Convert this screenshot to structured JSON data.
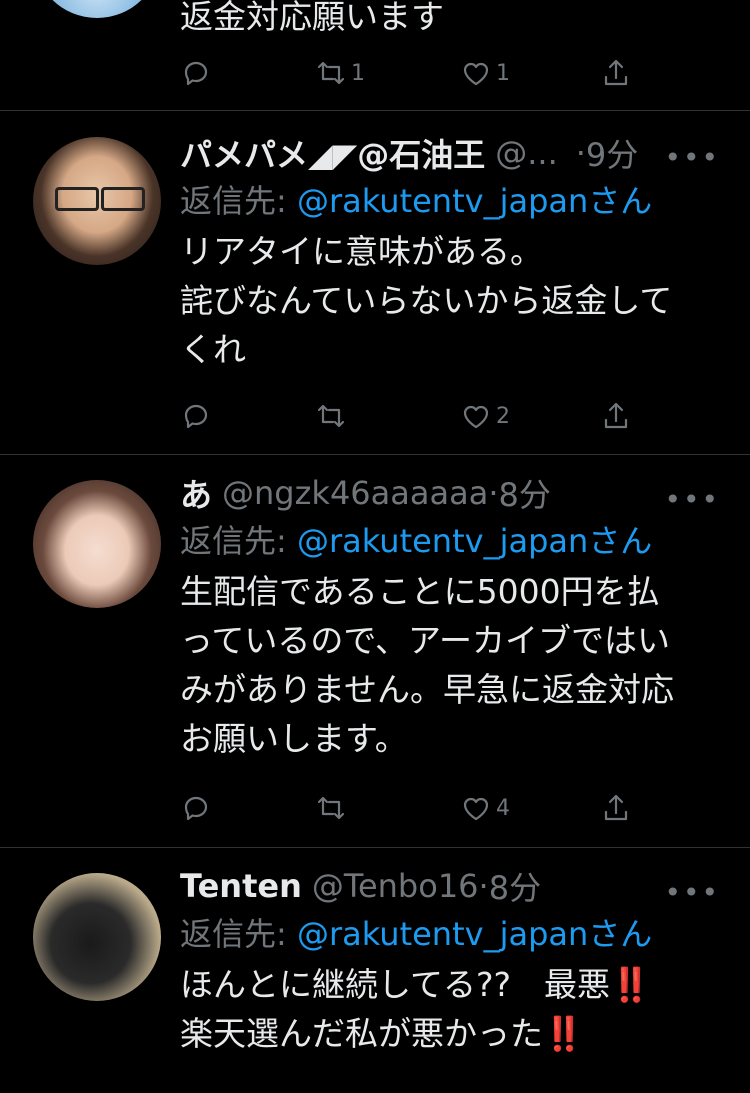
{
  "tweets": [
    {
      "text_lines": [
        "返金対応願います"
      ],
      "actions": {
        "reply": "",
        "retweet": "1",
        "like": "1"
      }
    },
    {
      "name": "パメパメ◢◤@石油王",
      "handle": "@...",
      "dot": "·",
      "time": "9分",
      "reply_label": "返信先: ",
      "reply_to": "@rakutentv_japanさん",
      "text_lines": [
        "リアタイに意味がある。",
        "詫びなんていらないから返金して",
        "くれ"
      ],
      "actions": {
        "reply": "",
        "retweet": "",
        "like": "2"
      }
    },
    {
      "name": "あ",
      "handle": "@ngzk46aaaaaa",
      "dot": "·",
      "time": "8分",
      "reply_label": "返信先: ",
      "reply_to": "@rakutentv_japanさん",
      "text_lines": [
        "生配信であることに5000円を払",
        "っているので、アーカイブではい",
        "みがありません。早急に返金対応",
        "お願いします。"
      ],
      "actions": {
        "reply": "",
        "retweet": "",
        "like": "4"
      }
    },
    {
      "name": "Tenten",
      "handle": "@Tenbo16",
      "dot": "·",
      "time": "8分",
      "reply_label": "返信先: ",
      "reply_to": "@rakutentv_japanさん",
      "text_lines": [
        "ほんとに継続してる??　最悪",
        "楽天選んだ私が悪かった"
      ],
      "bang": "‼️"
    }
  ],
  "more_label": "•••",
  "icons": [
    "reply-icon",
    "retweet-icon",
    "like-icon",
    "share-icon",
    "more-icon"
  ],
  "colors": {
    "background": "#000000",
    "mention": "#1d9bf0",
    "muted": "#71767b",
    "text": "#e7e9ea",
    "divider": "#2f3336"
  }
}
